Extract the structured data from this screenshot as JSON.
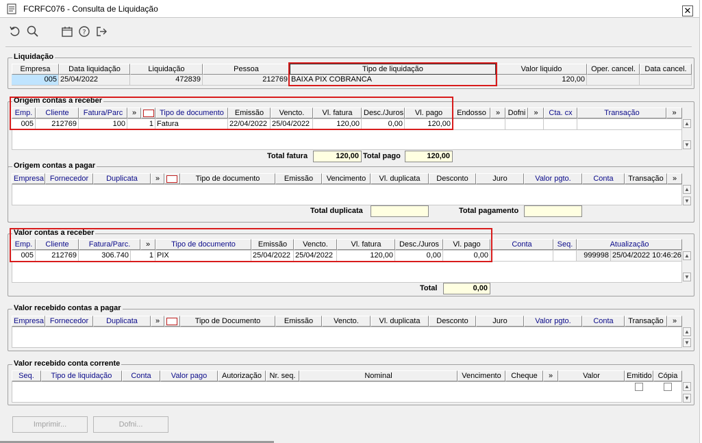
{
  "window": {
    "title": "FCRFC076 - Consulta de Liquidação",
    "close_glyph": "✕"
  },
  "toolbar": {
    "icons": [
      "refresh-icon",
      "search-icon",
      "calendar-icon",
      "help-icon",
      "exit-icon"
    ]
  },
  "liquidacao": {
    "legend": "Liquidação",
    "headers": [
      "Empresa",
      "Data liquidação",
      "Liquidação",
      "Pessoa",
      "Tipo de liquidação",
      "Valor liquido",
      "Oper. cancel.",
      "Data cancel."
    ],
    "row": [
      "005",
      "25/04/2022",
      "472839",
      "212769",
      "BAIXA PIX COBRANCA",
      "120,00",
      "",
      ""
    ]
  },
  "origem_receber": {
    "legend": "Origem contas a receber",
    "headers": [
      "Emp.",
      "Cliente",
      "Fatura/Parc",
      "»",
      "",
      "Tipo de documento",
      "Emissão",
      "Vencto.",
      "Vl. fatura",
      "Desc./Juros",
      "Vl. pago",
      "Endosso",
      "»",
      "Dofni",
      "»",
      "Cta. cx",
      "Transação",
      "»"
    ],
    "row": [
      "005",
      "212769",
      "100",
      "1",
      "Fatura",
      "22/04/2022",
      "25/04/2022",
      "120,00",
      "0,00",
      "120,00"
    ],
    "total_fatura_label": "Total fatura",
    "total_fatura": "120,00",
    "total_pago_label": "Total pago",
    "total_pago": "120,00"
  },
  "origem_pagar": {
    "legend": "Origem contas a pagar",
    "headers": [
      "Empresa",
      "Fornecedor",
      "Duplicata",
      "»",
      "",
      "Tipo de documento",
      "Emissão",
      "Vencimento",
      "Vl. duplicata",
      "Desconto",
      "Juro",
      "Valor pgto.",
      "Conta",
      "Transação",
      "»"
    ],
    "total_duplicata_label": "Total duplicata",
    "total_pagamento_label": "Total pagamento"
  },
  "valor_receber": {
    "legend": "Valor contas a receber",
    "headers": [
      "Emp.",
      "Cliente",
      "Fatura/Parc.",
      "»",
      "Tipo de documento",
      "Emissão",
      "Vencto.",
      "Vl. fatura",
      "Desc./Juros",
      "Vl. pago",
      "Conta",
      "Seq.",
      "Atualização"
    ],
    "row": [
      "005",
      "212769",
      "306.740",
      "1",
      "PIX",
      "25/04/2022",
      "25/04/2022",
      "120,00",
      "0,00",
      "0,00",
      "",
      "",
      "999998",
      "25/04/2022 10:46:26"
    ],
    "total_label": "Total",
    "total": "0,00"
  },
  "recebido_pagar": {
    "legend": "Valor recebido contas a pagar",
    "headers": [
      "Empresa",
      "Fornecedor",
      "Duplicata",
      "»",
      "",
      "Tipo de Documento",
      "Emissão",
      "Vencto.",
      "Vl. duplicata",
      "Desconto",
      "Juro",
      "Valor pgto.",
      "Conta",
      "Transação",
      "»"
    ]
  },
  "recebido_corrente": {
    "legend": "Valor recebido conta corrente",
    "headers": [
      "Seq.",
      "Tipo de liquidação",
      "Conta",
      "Valor pago",
      "Autorização",
      "Nr. seq.",
      "Nominal",
      "Vencimento",
      "Cheque",
      "»",
      "Valor",
      "Emitido",
      "Cópia"
    ]
  },
  "buttons": {
    "imprimir": "Imprimir...",
    "dofni": "Dofni..."
  },
  "colors": {
    "highlight_box": "#d81b1b",
    "total_bg": "#ffffe1",
    "header_blue": "#0a0a8a",
    "selected_cell": "#bfe4ff"
  }
}
